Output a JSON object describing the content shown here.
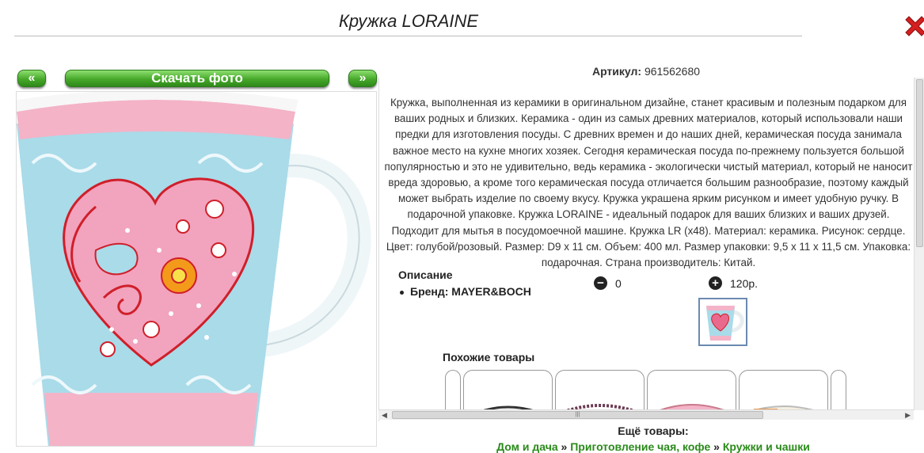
{
  "header": {
    "title": "Кружка LORAINE"
  },
  "icons": {
    "close": "close-x-icon",
    "minus": "minus-circle-icon",
    "plus": "plus-circle-icon"
  },
  "gallery": {
    "prev_label": "«",
    "download_label": "Скачать фото",
    "next_label": "»"
  },
  "product": {
    "article_label": "Артикул:",
    "article_value": "961562680",
    "description": "Кружка, выполненная из керамики в оригинальном дизайне, станет красивым и полезным подарком для ваших родных и близких. Керамика - один из самых древних материалов, который использовали наши предки для изготовления посуды. С древних времен и до наших дней, керамическая посуда занимала важное место на кухне многих хозяек. Сегодня керамическая посуда по-прежнему пользуется большой популярностью и это не удивительно, ведь керамика - экологически чистый материал, который не наносит вреда здоровью, а кроме того керамическая посуда отличается большим разнообразие, поэтому каждый может выбрать изделие по своему вкусу. Кружка украшена ярким рисунком и имеет удобную ручку. В подарочной упаковке. Кружка LORAINE - идеальный подарок для ваших близких и ваших друзей. Подходит для мытья в посудомоечной машине. Кружка LR (x48). Материал: керамика. Рисунок: сердце. Цвет: голубой/розовый. Размер: D9 х 11 см. Объем: 400 мл. Размер упаковки: 9,5 х 11 х 11,5 см. Упаковка: подарочная. Страна производитель: Китай.",
    "section_label": "Описание",
    "brand_label": "Бренд: MAYER&BOCH",
    "quantity": "0",
    "price": "120р."
  },
  "similar": {
    "title": "Похожие товары"
  },
  "footer": {
    "more_label": "Ещё товары:",
    "crumbs": [
      "Дом и дача",
      "Приготовление чая, кофе",
      "Кружки и чашки"
    ],
    "sep": "»"
  },
  "colors": {
    "button_green": "#46a82a",
    "link_green": "#2a8a1a",
    "mug_blue": "#a9dbe9",
    "mug_pink": "#f4a7c0",
    "close_red": "#d42020"
  }
}
